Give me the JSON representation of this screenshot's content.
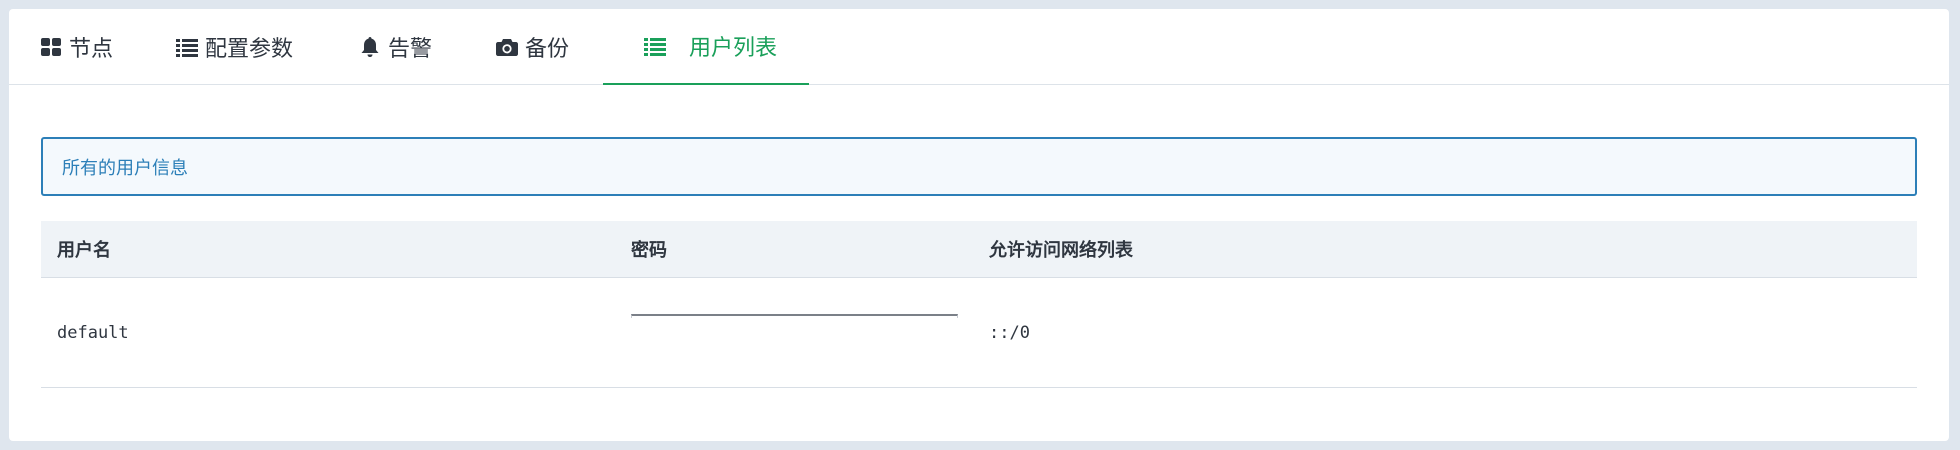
{
  "tabs": [
    {
      "label": "节点",
      "icon": "grid-icon"
    },
    {
      "label": "配置参数",
      "icon": "list-icon"
    },
    {
      "label": "告警",
      "icon": "bell-icon"
    },
    {
      "label": "备份",
      "icon": "camera-icon"
    },
    {
      "label": "用户列表",
      "icon": "list-icon",
      "active": true
    }
  ],
  "accent_color": "#1aa05a",
  "info_color": "#2c7fb8",
  "info": {
    "text": "所有的用户信息"
  },
  "table": {
    "headers": [
      "用户名",
      "密码",
      "允许访问网络列表"
    ],
    "rows": [
      {
        "username": "default",
        "password": "",
        "networks": "::/0"
      }
    ]
  }
}
